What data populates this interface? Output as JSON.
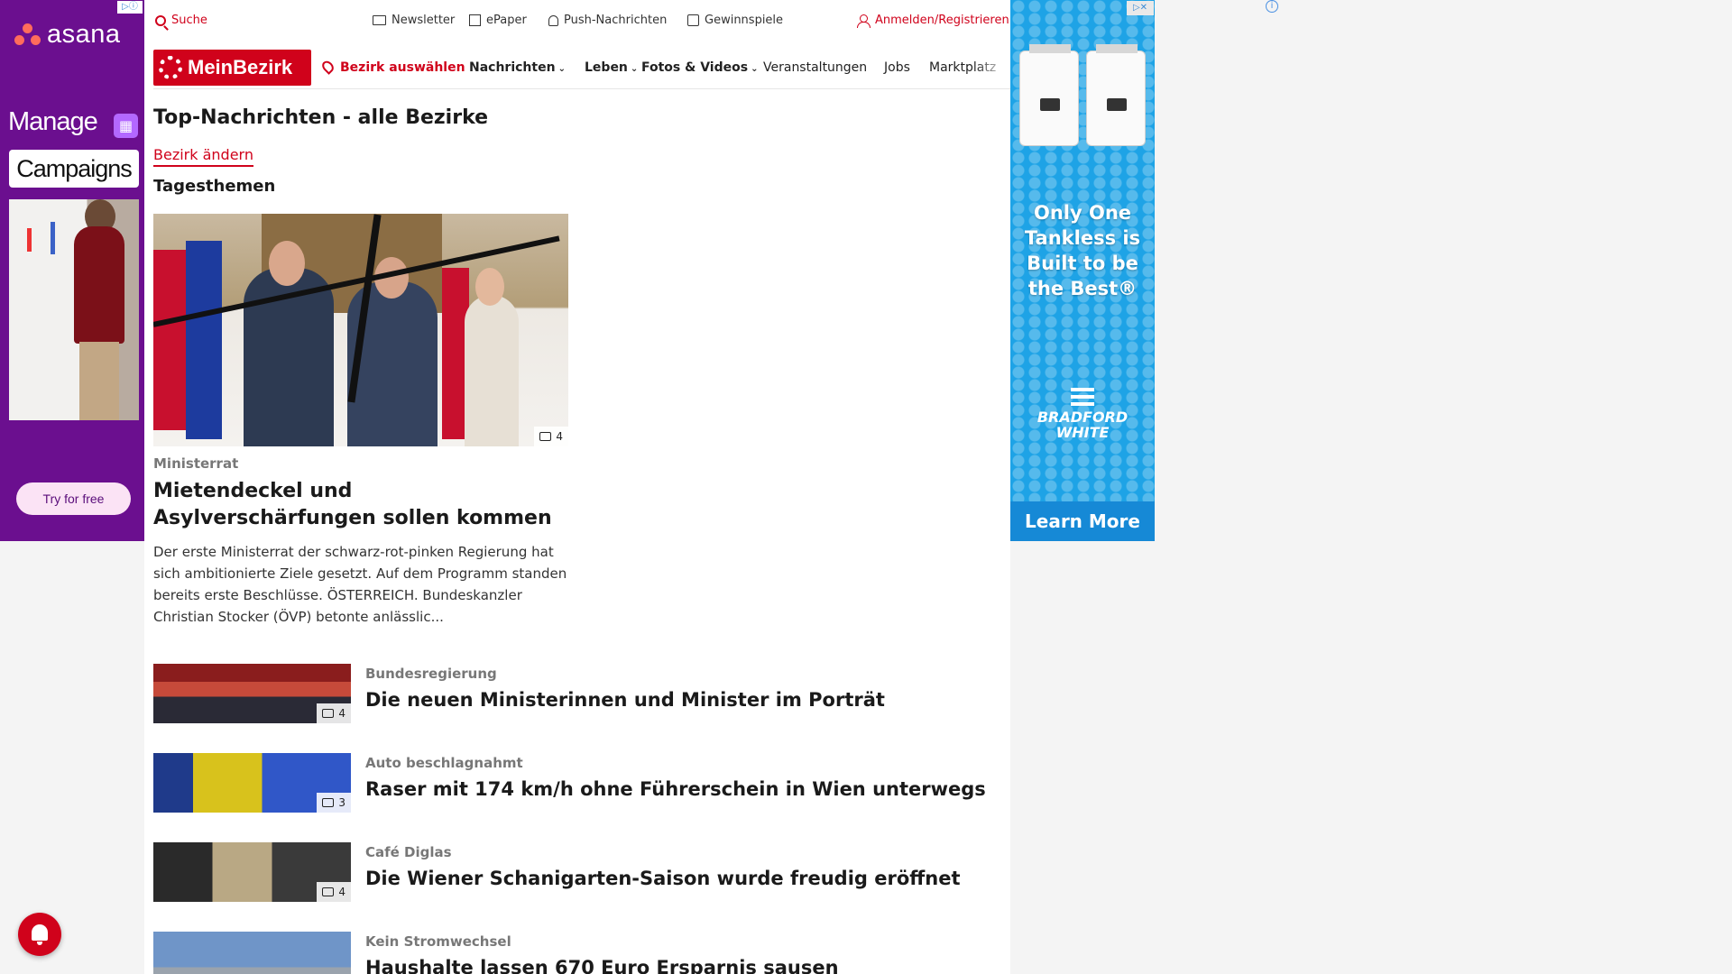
{
  "ads": {
    "left": {
      "brand": "asana",
      "line1": "Manage",
      "line2": "Campaigns",
      "cta": "Try for free",
      "adchoice": "▷ⓘ"
    },
    "right": {
      "headline": "Only One Tankless is Built to be the Best®",
      "brand": "BRADFORD WHITE",
      "cta": "Learn More",
      "adchoice": "▷✕",
      "info": "i"
    }
  },
  "topbar": {
    "search": "Suche",
    "newsletter": "Newsletter",
    "epaper": "ePaper",
    "push": "Push-Nachrichten",
    "contests": "Gewinnspiele",
    "login": "Anmelden/Registrieren"
  },
  "nav": {
    "logo": "MeinBezirk",
    "district_select": "Bezirk auswählen",
    "items": [
      "Nachrichten",
      "Leben",
      "Fotos & Videos",
      "Veranstaltungen",
      "Jobs",
      "Marktplatz"
    ]
  },
  "page": {
    "title": "Top-Nachrichten - alle Bezirke",
    "change_district": "Bezirk ändern",
    "section": "Tagesthemen"
  },
  "lead": {
    "photo_count": "4",
    "category": "Ministerrat",
    "title": "Mietendeckel und Asylverschärfungen sollen kommen",
    "text": "Der erste Ministerrat der schwarz-rot-pinken Regierung hat sich ambitionierte Ziele gesetzt. Auf dem Programm standen bereits erste Beschlüsse. ÖSTERREICH. Bundeskanzler Christian Stocker (ÖVP) betonte anlässlic..."
  },
  "stories": [
    {
      "category": "Bundesregierung",
      "title": "Die neuen Ministerinnen und Minister im Porträt",
      "photo_count": "4"
    },
    {
      "category": "Auto beschlagnahmt",
      "title": "Raser mit 174 km/h ohne Führerschein in Wien unterwegs",
      "photo_count": "3"
    },
    {
      "category": "Café Diglas",
      "title": "Die Wiener Schanigarten-Saison wurde freudig eröffnet",
      "photo_count": "4"
    },
    {
      "category": "Kein Stromwechsel",
      "title": "Haushalte lassen 670 Euro Ersparnis sausen",
      "photo_count": ""
    }
  ],
  "colors": {
    "brand_red": "#d0021b",
    "asana_purple": "#6b0f8f",
    "bradford_blue": "#1ea3e6"
  }
}
